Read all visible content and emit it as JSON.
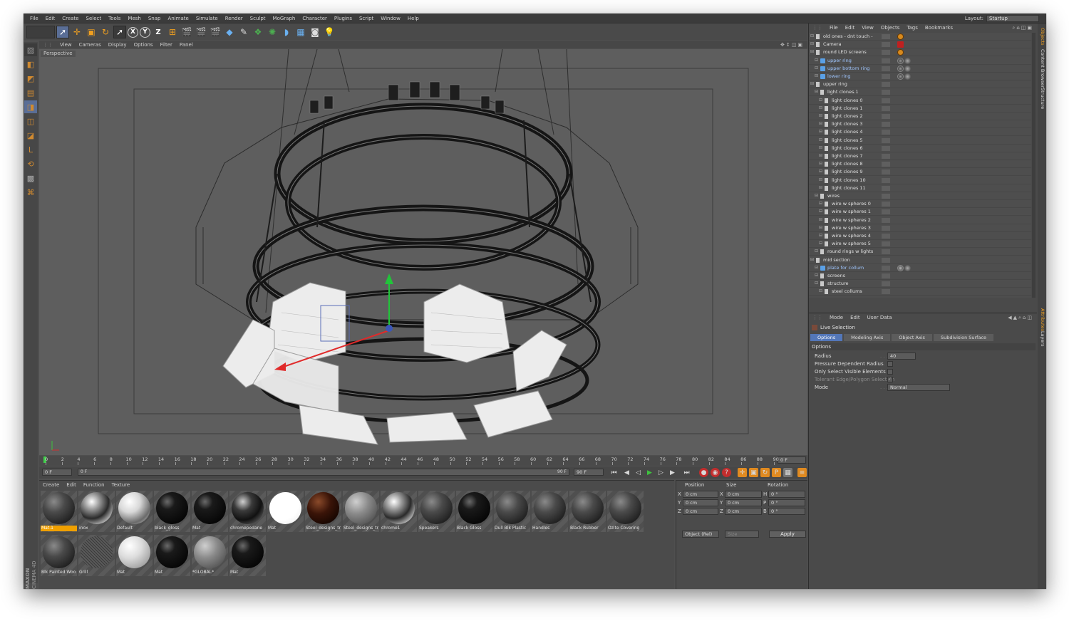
{
  "menubar": {
    "items": [
      "File",
      "Edit",
      "Create",
      "Select",
      "Tools",
      "Mesh",
      "Snap",
      "Animate",
      "Simulate",
      "Render",
      "Sculpt",
      "MoGraph",
      "Character",
      "Plugins",
      "Script",
      "Window",
      "Help"
    ],
    "layout_label": "Layout:",
    "layout_value": "Startup"
  },
  "viewport": {
    "menu": [
      "View",
      "Cameras",
      "Display",
      "Options",
      "Filter",
      "Panel"
    ],
    "label": "Perspective"
  },
  "timeline": {
    "ticks": [
      "0",
      "2",
      "4",
      "6",
      "8",
      "10",
      "12",
      "14",
      "16",
      "18",
      "20",
      "22",
      "24",
      "26",
      "28",
      "30",
      "32",
      "34",
      "36",
      "38",
      "40",
      "42",
      "44",
      "46",
      "48",
      "50",
      "52",
      "54",
      "56",
      "58",
      "60",
      "62",
      "64",
      "66",
      "68",
      "70",
      "72",
      "74",
      "76",
      "78",
      "80",
      "82",
      "84",
      "86",
      "88",
      "90"
    ],
    "current_frame": "0 F",
    "start_field": "0 F",
    "range_start": "0 F",
    "range_end": "90 F",
    "end_field": "90 F"
  },
  "material_manager": {
    "menu": [
      "Create",
      "Edit",
      "Function",
      "Texture"
    ],
    "materials": [
      {
        "label": "Mat.1",
        "style": "dark-grey",
        "selected": true
      },
      {
        "label": "inox",
        "style": "chrome"
      },
      {
        "label": "Default",
        "style": "light-chrome"
      },
      {
        "label": "black_gloss",
        "style": "black"
      },
      {
        "label": "Mat",
        "style": "black"
      },
      {
        "label": "chromepedane",
        "style": "dark-chrome"
      },
      {
        "label": "Mat",
        "style": "white"
      },
      {
        "label": "Steel_designs_tr",
        "style": "brown"
      },
      {
        "label": "Steel_designs_tr",
        "style": "grey"
      },
      {
        "label": "chrome1",
        "style": "chrome"
      },
      {
        "label": "Speakers",
        "style": "dark-grey"
      },
      {
        "label": "Black Gloss",
        "style": "black"
      },
      {
        "label": "Dull Blk Plastic",
        "style": "dark-grey"
      },
      {
        "label": "Handles",
        "style": "dark-grey"
      },
      {
        "label": "Black Rubber",
        "style": "dark-grey"
      },
      {
        "label": "Ozite Covering",
        "style": "dark-grey"
      },
      {
        "label": "Blk Painted Woo",
        "style": "dark-grey"
      },
      {
        "label": "Grill",
        "style": "grill"
      },
      {
        "label": "Mat",
        "style": "light"
      },
      {
        "label": "Mat",
        "style": "black"
      },
      {
        "label": "*GLOBAL*",
        "style": "grey"
      },
      {
        "label": "Mat",
        "style": "black"
      }
    ]
  },
  "coordinates": {
    "headers": [
      "Position",
      "Size",
      "Rotation"
    ],
    "rows": [
      {
        "axis": "X",
        "pos": "0 cm",
        "size_axis": "X",
        "size": "0 cm",
        "rot_axis": "H",
        "rot": "0 °"
      },
      {
        "axis": "Y",
        "pos": "0 cm",
        "size_axis": "Y",
        "size": "0 cm",
        "rot_axis": "P",
        "rot": "0 °"
      },
      {
        "axis": "Z",
        "pos": "0 cm",
        "size_axis": "Z",
        "size": "0 cm",
        "rot_axis": "B",
        "rot": "0 °"
      }
    ],
    "mode": "Object (Rel)",
    "size_mode": "Size",
    "apply": "Apply"
  },
  "object_manager": {
    "menu": [
      "File",
      "Edit",
      "View",
      "Objects",
      "Tags",
      "Bookmarks"
    ],
    "rows": [
      {
        "name": "old ones - dnt touch -",
        "depth": 0,
        "type": "null",
        "tag": "orange"
      },
      {
        "name": "Camera",
        "depth": 0,
        "type": "camera",
        "tag": "red"
      },
      {
        "name": "round LED screens",
        "depth": 0,
        "type": "null",
        "tag": "orange"
      },
      {
        "name": "upper ring",
        "depth": 1,
        "type": "poly",
        "tag": "mat"
      },
      {
        "name": "upper bottom ring",
        "depth": 1,
        "type": "poly",
        "tag": "mat"
      },
      {
        "name": "lower ring",
        "depth": 1,
        "type": "poly",
        "tag": "mat"
      },
      {
        "name": "upper ring",
        "depth": 0,
        "type": "null",
        "tag": ""
      },
      {
        "name": "light clones.1",
        "depth": 1,
        "type": "null",
        "tag": ""
      },
      {
        "name": "light clones 0",
        "depth": 2,
        "type": "null",
        "tag": ""
      },
      {
        "name": "light clones 1",
        "depth": 2,
        "type": "null",
        "tag": ""
      },
      {
        "name": "light clones 2",
        "depth": 2,
        "type": "null",
        "tag": ""
      },
      {
        "name": "light clones 3",
        "depth": 2,
        "type": "null",
        "tag": ""
      },
      {
        "name": "light clones 4",
        "depth": 2,
        "type": "null",
        "tag": ""
      },
      {
        "name": "light clones 5",
        "depth": 2,
        "type": "null",
        "tag": ""
      },
      {
        "name": "light clones 6",
        "depth": 2,
        "type": "null",
        "tag": ""
      },
      {
        "name": "light clones 7",
        "depth": 2,
        "type": "null",
        "tag": ""
      },
      {
        "name": "light clones 8",
        "depth": 2,
        "type": "null",
        "tag": ""
      },
      {
        "name": "light clones 9",
        "depth": 2,
        "type": "null",
        "tag": ""
      },
      {
        "name": "light clones 10",
        "depth": 2,
        "type": "null",
        "tag": ""
      },
      {
        "name": "light clones 11",
        "depth": 2,
        "type": "null",
        "tag": ""
      },
      {
        "name": "wires",
        "depth": 1,
        "type": "null",
        "tag": ""
      },
      {
        "name": "wire w spheres 0",
        "depth": 2,
        "type": "null",
        "tag": ""
      },
      {
        "name": "wire w spheres 1",
        "depth": 2,
        "type": "null",
        "tag": ""
      },
      {
        "name": "wire w spheres 2",
        "depth": 2,
        "type": "null",
        "tag": ""
      },
      {
        "name": "wire w spheres 3",
        "depth": 2,
        "type": "null",
        "tag": ""
      },
      {
        "name": "wire w spheres 4",
        "depth": 2,
        "type": "null",
        "tag": ""
      },
      {
        "name": "wire w spheres 5",
        "depth": 2,
        "type": "null",
        "tag": ""
      },
      {
        "name": "round rings w lights",
        "depth": 1,
        "type": "null",
        "tag": ""
      },
      {
        "name": "mid section",
        "depth": 0,
        "type": "null",
        "tag": ""
      },
      {
        "name": "plate for collum",
        "depth": 1,
        "type": "poly",
        "tag": "mat2"
      },
      {
        "name": "screens",
        "depth": 1,
        "type": "null",
        "tag": ""
      },
      {
        "name": "structure",
        "depth": 1,
        "type": "null",
        "tag": ""
      },
      {
        "name": "steel collums",
        "depth": 2,
        "type": "null",
        "tag": ""
      }
    ]
  },
  "attributes": {
    "menu": [
      "Mode",
      "Edit",
      "User Data"
    ],
    "tool_name": "Live Selection",
    "tabs": [
      "Options",
      "Modeling Axis",
      "Object Axis",
      "Subdivision Surface"
    ],
    "section": "Options",
    "fields": [
      {
        "label": "Radius",
        "value": "40",
        "kind": "number"
      },
      {
        "label": "Pressure Dependent Radius",
        "value": "",
        "kind": "checkbox"
      },
      {
        "label": "Only Select Visible Elements",
        "value": "",
        "kind": "checkbox"
      },
      {
        "label": "Tolerant Edge/Polygon Selection",
        "value": "✓",
        "kind": "checkbox-dim"
      },
      {
        "label": "Mode",
        "value": "Normal",
        "kind": "select"
      }
    ]
  },
  "side_tabs": [
    "Objects",
    "Content Browser",
    "Structure",
    "Attributes",
    "Layers"
  ],
  "brand": {
    "line1": "MAXON",
    "line2": "CINEMA 4D"
  }
}
